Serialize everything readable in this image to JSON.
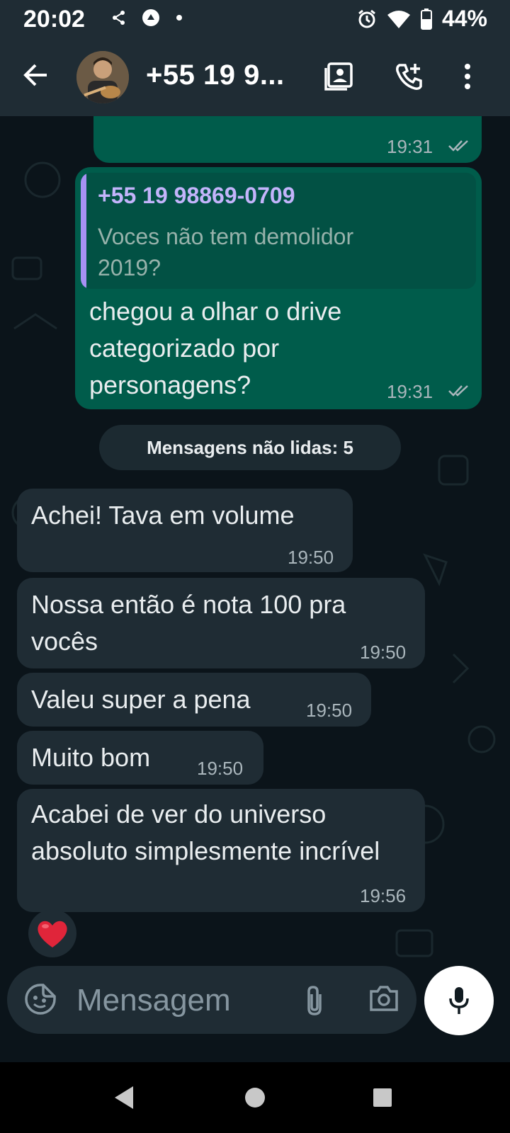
{
  "status_bar": {
    "time": "20:02",
    "battery": "44%",
    "icons": [
      "share-icon",
      "drive-icon",
      "dot-icon",
      "alarm-icon",
      "wifi-icon",
      "battery-icon"
    ]
  },
  "header": {
    "contact_name": "+55 19 9...",
    "icons": [
      "back-arrow-icon",
      "avatar",
      "contacts-icon",
      "add-call-icon",
      "more-vert-icon"
    ]
  },
  "messages": {
    "top_partial": {
      "time": "19:31",
      "status": "read"
    },
    "reply": {
      "quote_author": "+55 19 98869-0709",
      "quote_text": "Voces não tem demolidor 2019?",
      "text": "chegou a olhar o drive categorizado por personagens?",
      "time": "19:31",
      "status": "read"
    },
    "unread_label": "Mensagens não lidas: 5",
    "incoming": [
      {
        "text": "Achei! Tava em volume",
        "time": "19:50"
      },
      {
        "text": "Nossa então é nota 100 pra vocês",
        "time": "19:50"
      },
      {
        "text": "Valeu super a pena",
        "time": "19:50"
      },
      {
        "text": "Muito bom",
        "time": "19:50"
      },
      {
        "text": "Acabei de ver do universo absoluto simplesmente incrível",
        "time": "19:56",
        "reaction": "heart"
      }
    ]
  },
  "composer": {
    "placeholder": "Mensagem",
    "icons": [
      "sticker-icon",
      "attach-icon",
      "camera-icon",
      "mic-icon"
    ]
  },
  "nav": {
    "icons": [
      "back-triangle-icon",
      "home-circle-icon",
      "recents-square-icon"
    ]
  },
  "colors": {
    "header_bg": "#1f2c34",
    "chat_bg": "#0b141a",
    "outgoing_bubble": "#005c4b",
    "incoming_bubble": "#1f2c34",
    "quote_accent": "#a791f4",
    "read_tick": "#aab6bc"
  }
}
